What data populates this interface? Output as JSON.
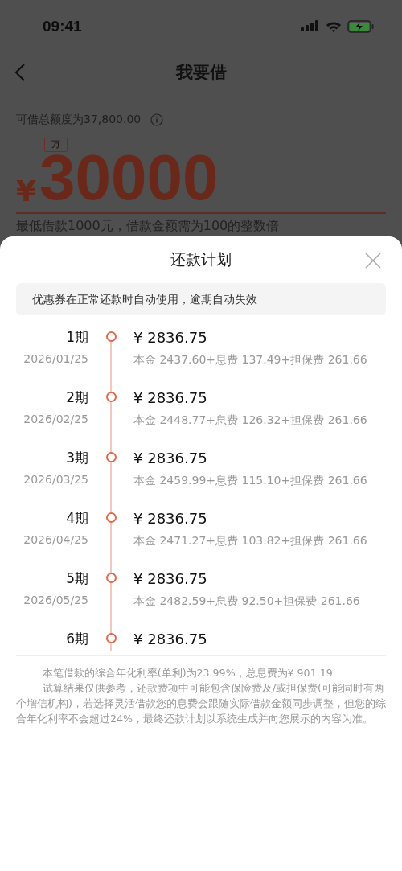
{
  "status_bar": {
    "time": "09:41"
  },
  "nav": {
    "title": "我要借"
  },
  "loan": {
    "limit_text": "可借总额度为37,800.00",
    "unit_tag": "万",
    "currency": "¥",
    "amount": "30000",
    "hint": "最低借款1000元，借款金额需为100的整数倍"
  },
  "sheet": {
    "title": "还款计划",
    "notice": "优惠券在正常还款时自动使用，逾期自动失效",
    "installments": [
      {
        "period": "1期",
        "date": "2026/01/25",
        "amount": "¥ 2836.75",
        "breakdown": "本金 2437.60+息费 137.49+担保费 261.66"
      },
      {
        "period": "2期",
        "date": "2026/02/25",
        "amount": "¥ 2836.75",
        "breakdown": "本金 2448.77+息费 126.32+担保费 261.66"
      },
      {
        "period": "3期",
        "date": "2026/03/25",
        "amount": "¥ 2836.75",
        "breakdown": "本金 2459.99+息费 115.10+担保费 261.66"
      },
      {
        "period": "4期",
        "date": "2026/04/25",
        "amount": "¥ 2836.75",
        "breakdown": "本金 2471.27+息费 103.82+担保费 261.66"
      },
      {
        "period": "5期",
        "date": "2026/05/25",
        "amount": "¥ 2836.75",
        "breakdown": "本金 2482.59+息费 92.50+担保费 261.66"
      },
      {
        "period": "6期",
        "amount": "¥ 2836.75"
      }
    ],
    "summary": [
      "本笔借款的综合年化利率(单利)为23.99%，总息费为¥ 901.19",
      "试算结果仅供参考，还款费项中可能包含保险费及/或担保费(可能同时有两个增信机构)，若选择灵活借款您的息费会跟随实际借款金额同步调整，但您的综合年化利率不会超过24%，最终还款计划以系统生成并向您展示的内容为准。"
    ]
  }
}
